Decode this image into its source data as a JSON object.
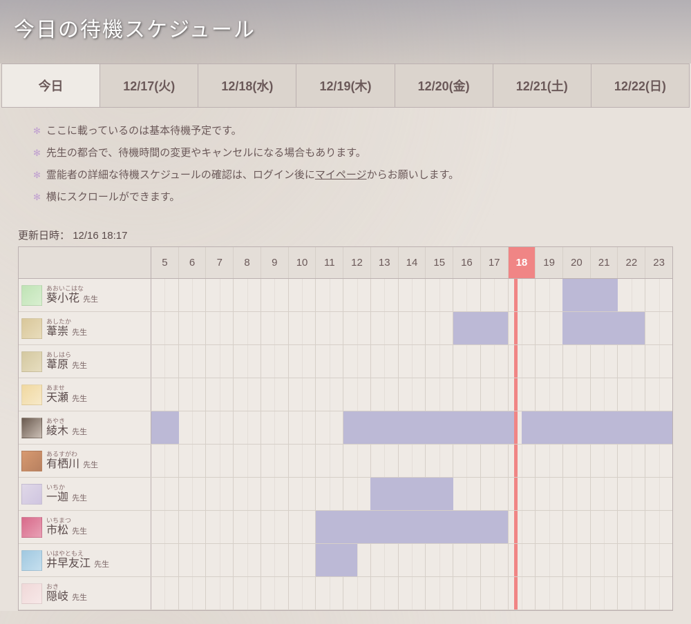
{
  "title": "今日の待機スケジュール",
  "tabs": [
    "今日",
    "12/17(火)",
    "12/18(水)",
    "12/19(木)",
    "12/20(金)",
    "12/21(土)",
    "12/22(日)"
  ],
  "active_tab": 0,
  "notes": [
    {
      "text": "ここに載っているのは基本待機予定です。"
    },
    {
      "text": "先生の都合で、待機時間の変更やキャンセルになる場合もあります。"
    },
    {
      "text": "霊能者の詳細な待機スケジュールの確認は、ログイン後に",
      "link": "マイページ",
      "after": "からお願いします。"
    },
    {
      "text": "横にスクロールができます。"
    }
  ],
  "update_label": "更新日時：",
  "update_value": "12/16 18:17",
  "hours": [
    5,
    6,
    7,
    8,
    9,
    10,
    11,
    12,
    13,
    14,
    15,
    16,
    17,
    18,
    19,
    20,
    21,
    22,
    23
  ],
  "current_hour": 18,
  "current_fraction": 0.28,
  "suffix": "先生",
  "rows": [
    {
      "ruby": "あおいこはな",
      "name": "葵小花",
      "slots": [
        [
          20,
          22
        ]
      ]
    },
    {
      "ruby": "あしたか",
      "name": "葦崇",
      "slots": [
        [
          16,
          18
        ],
        [
          20,
          23
        ]
      ]
    },
    {
      "ruby": "あしはら",
      "name": "葦原",
      "slots": []
    },
    {
      "ruby": "あませ",
      "name": "天瀬",
      "slots": []
    },
    {
      "ruby": "あやき",
      "name": "綾木",
      "slots": [
        [
          5,
          6
        ],
        [
          12,
          18.28
        ],
        [
          18.5,
          24
        ]
      ]
    },
    {
      "ruby": "あるすがわ",
      "name": "有栖川",
      "slots": []
    },
    {
      "ruby": "いちか",
      "name": "一迦",
      "slots": [
        [
          13,
          16
        ]
      ]
    },
    {
      "ruby": "いちまつ",
      "name": "市松",
      "slots": [
        [
          11,
          18
        ]
      ]
    },
    {
      "ruby": "いはやともえ",
      "name": "井早友江",
      "slots": [
        [
          11,
          12.5
        ]
      ]
    },
    {
      "ruby": "おき",
      "name": "隠岐",
      "slots": []
    }
  ],
  "avatar_gradients": [
    [
      "#bfe3b5",
      "#d8efd0"
    ],
    [
      "#d9c79a",
      "#e8dcbb"
    ],
    [
      "#d4c8a0",
      "#e6ddbf"
    ],
    [
      "#f0d8a0",
      "#f7e9c8"
    ],
    [
      "#6a5a4f",
      "#cbbfb5"
    ],
    [
      "#d89a70",
      "#b78060"
    ],
    [
      "#e0d8e8",
      "#cfc5e0"
    ],
    [
      "#d86a8a",
      "#e8a0b5"
    ],
    [
      "#a0c8e0",
      "#c5dfee"
    ],
    [
      "#f0d8d8",
      "#f7e8e8"
    ]
  ]
}
